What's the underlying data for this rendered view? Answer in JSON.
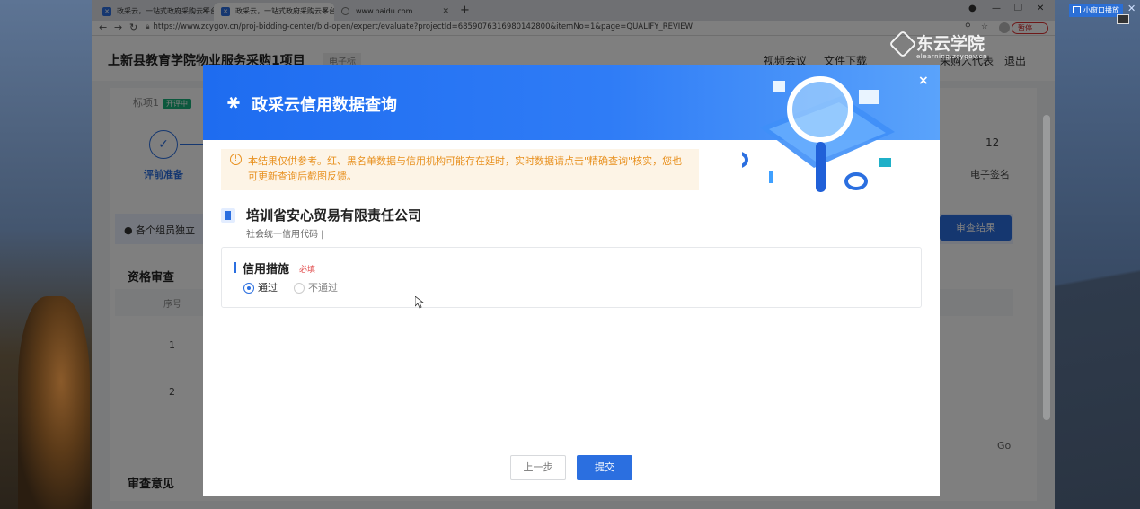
{
  "browser": {
    "tabs": [
      {
        "label": "政采云，一站式政府采购云平台",
        "active": false
      },
      {
        "label": "政采云，一站式政府采购云平台",
        "active": true
      },
      {
        "label": "www.baidu.com",
        "active": false
      }
    ],
    "url": "https://www.zcygov.cn/proj-bidding-center/bid-open/expert/evaluate?projectId=685907631698014280​0&itemNo=1&page=QUALIFY_REVIEW",
    "pause_label": "暂停"
  },
  "overlay_app": {
    "mini_window_label": "小窗口播放"
  },
  "watermark": {
    "main": "东云学院",
    "sub": "elearning.zcygov.cn"
  },
  "page": {
    "project_title": "上新县教育学院物业服务采购1项目",
    "project_tag": "电子标",
    "header_links": [
      "视频会议",
      "文件下载",
      "采购人代表",
      "退出"
    ],
    "bid_tab": "标项1",
    "bid_status": "开评中",
    "step_label": "评前准备",
    "step_count": "12",
    "step_last_label": "电子签名",
    "notice_text": "各个组员独立",
    "notice_button": "审查结果",
    "section_qualify": "资格审查",
    "table_header_seq": "序号",
    "rows": [
      "1",
      "2"
    ],
    "go_label": "Go",
    "section_opinion": "审查意见"
  },
  "modal": {
    "title": "政采云信用数据查询",
    "close": "×",
    "notice": "本结果仅供参考。红、黑名单数据与信用机构可能存在延时，实时数据请点击\"精确查询\"核实，您也可更新查询后截图反馈。",
    "company_name": "培训省安心贸易有限责任公司",
    "credit_code_label": "社会统一信用代码 |",
    "measure_title": "信用措施",
    "required_label": "必填",
    "options": [
      {
        "label": "通过",
        "selected": true
      },
      {
        "label": "不通过",
        "selected": false
      }
    ],
    "prev_button": "上一步",
    "submit_button": "提交",
    "accent_color": "#2b6fe0"
  }
}
